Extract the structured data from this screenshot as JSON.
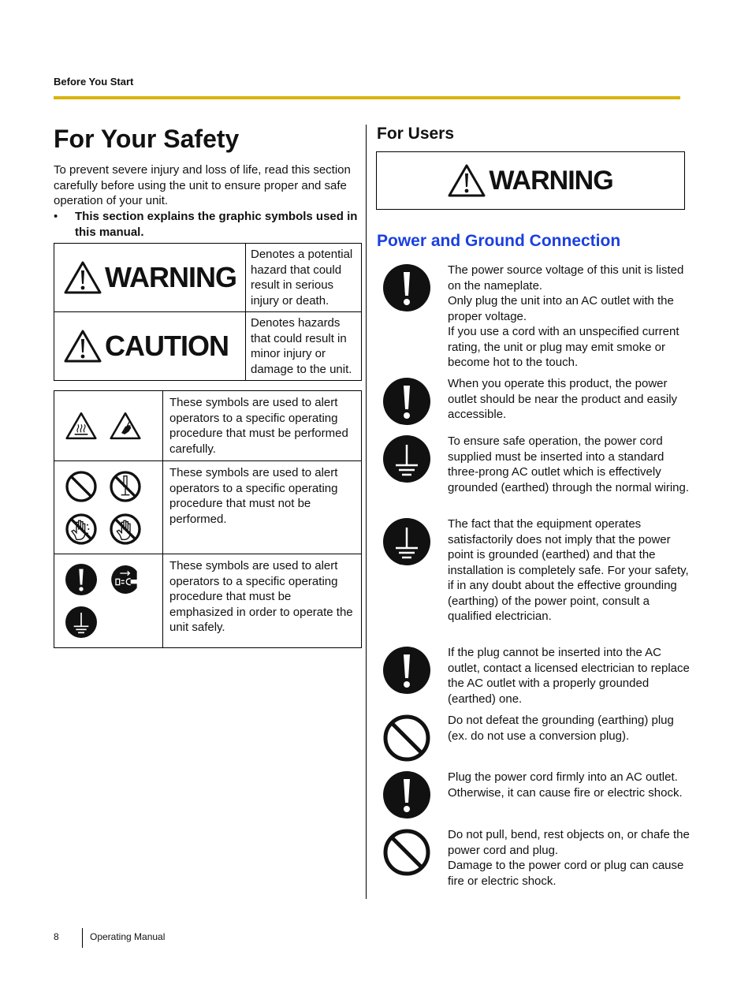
{
  "header": {
    "section": "Before You Start",
    "rule_color": "#d9b30a"
  },
  "page_title": "For Your Safety",
  "intro": "To prevent severe injury and loss of life, read this section carefully before using the unit to ensure proper and safe operation of your unit.",
  "bullet": {
    "marker": "•",
    "text": "This section explains the graphic symbols used in this manual."
  },
  "signal_words": [
    {
      "word": "WARNING",
      "icon": "warning-triangle-icon",
      "description": "Denotes a potential hazard that could result in serious injury or death."
    },
    {
      "word": "CAUTION",
      "icon": "warning-triangle-icon",
      "description": "Denotes hazards that could result in minor injury or damage to the unit."
    }
  ],
  "symbol_rows": [
    {
      "icons": [
        "hot-surface-icon",
        "electric-shock-hand-icon"
      ],
      "description": "These symbols are used to alert operators to a specific operating procedure that must be performed carefully."
    },
    {
      "icons": [
        "prohibition-icon",
        "no-disassembly-icon",
        "no-touch-wet-hand-icon",
        "no-touch-hand-icon"
      ],
      "description": "These symbols are used to alert operators to a specific operating procedure that must not be performed."
    },
    {
      "icons": [
        "mandatory-exclamation-icon",
        "unplug-icon",
        "ground-icon"
      ],
      "description": "These symbols are used to alert operators to a specific operating procedure that must be emphasized in order to operate the unit safely."
    }
  ],
  "right": {
    "for_users": "For Users",
    "warning_banner": "WARNING",
    "section_heading": "Power and Ground Connection",
    "heading_color": "#1a3fe0",
    "items": [
      {
        "icon": "mandatory-exclamation-icon",
        "text": "The power source voltage of this unit is listed on the nameplate.\nOnly plug the unit into an AC outlet with the proper voltage.\nIf you use a cord with an unspecified current rating, the unit or plug may emit smoke or become hot to the touch."
      },
      {
        "icon": "mandatory-exclamation-icon",
        "text": "When you operate this product, the power outlet should be near the product and easily accessible."
      },
      {
        "icon": "ground-icon",
        "text": "To ensure safe operation, the power cord supplied must be inserted into a standard three-prong AC outlet which is effectively grounded (earthed) through the normal wiring."
      },
      {
        "icon": "ground-icon",
        "text": "The fact that the equipment operates satisfactorily does not imply that the power point is grounded (earthed) and that the installation is completely safe. For your safety, if in any doubt about the effective grounding (earthing) of the power point, consult a qualified electrician."
      },
      {
        "icon": "mandatory-exclamation-icon",
        "text": "If the plug cannot be inserted into the AC outlet, contact a licensed electrician to replace the AC outlet with a properly grounded (earthed) one."
      },
      {
        "icon": "prohibition-icon",
        "text": "Do not defeat the grounding (earthing) plug (ex. do not use a conversion plug)."
      },
      {
        "icon": "mandatory-exclamation-icon",
        "text": "Plug the power cord firmly into an AC outlet. Otherwise, it can cause fire or electric shock."
      },
      {
        "icon": "prohibition-icon",
        "text": "Do not pull, bend, rest objects on, or chafe the power cord and plug.\nDamage to the power cord or plug can cause fire or electric shock."
      }
    ]
  },
  "footer": {
    "page_number": "8",
    "title": "Operating Manual"
  }
}
